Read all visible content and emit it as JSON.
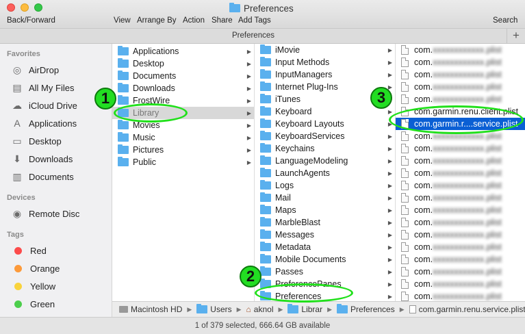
{
  "window": {
    "title": "Preferences",
    "toolbar": {
      "back_forward": "Back/Forward",
      "view": "View",
      "arrange_by": "Arrange By",
      "action": "Action",
      "share": "Share",
      "add_tags": "Add Tags",
      "search": "Search"
    },
    "tab_title": "Preferences",
    "plus": "+"
  },
  "sidebar": {
    "favorites_header": "Favorites",
    "favorites": [
      {
        "label": "AirDrop",
        "icon": "airdrop-icon"
      },
      {
        "label": "All My Files",
        "icon": "all-files-icon"
      },
      {
        "label": "iCloud Drive",
        "icon": "cloud-icon"
      },
      {
        "label": "Applications",
        "icon": "applications-icon"
      },
      {
        "label": "Desktop",
        "icon": "desktop-icon"
      },
      {
        "label": "Downloads",
        "icon": "downloads-icon"
      },
      {
        "label": "Documents",
        "icon": "documents-icon"
      }
    ],
    "devices_header": "Devices",
    "devices": [
      {
        "label": "Remote Disc",
        "icon": "disc-icon"
      }
    ],
    "tags_header": "Tags",
    "tags": [
      {
        "label": "Red",
        "color": "#fc4b4b"
      },
      {
        "label": "Orange",
        "color": "#fd9a3a"
      },
      {
        "label": "Yellow",
        "color": "#f9d33c"
      },
      {
        "label": "Green",
        "color": "#4cce4c"
      }
    ]
  },
  "column1": [
    {
      "label": "Applications"
    },
    {
      "label": "Desktop"
    },
    {
      "label": "Documents"
    },
    {
      "label": "Downloads"
    },
    {
      "label": "FrostWire"
    },
    {
      "label": "Library",
      "selected": true
    },
    {
      "label": "Movies"
    },
    {
      "label": "Music"
    },
    {
      "label": "Pictures"
    },
    {
      "label": "Public"
    }
  ],
  "column2": [
    "iMovie",
    "Input Methods",
    "InputManagers",
    "Internet Plug-Ins",
    "iTunes",
    "Keyboard",
    "Keyboard Layouts",
    "KeyboardServices",
    "Keychains",
    "LanguageModeling",
    "LaunchAgents",
    "Logs",
    "Mail",
    "Maps",
    "MarbleBlast",
    "Messages",
    "Metadata",
    "Mobile Documents",
    "Passes",
    "PreferencePanes",
    "Preferences"
  ],
  "column3": {
    "blurred_prefix": "com.",
    "visible_items": [
      {
        "label": "com.garmin.renu.client.plist",
        "index": 5
      },
      {
        "label": "com.garmin.r....service.plist",
        "index": 6,
        "selected": true
      }
    ],
    "blurred_fill": "xxxxxxxxxxxx.plist"
  },
  "pathbar": {
    "segments": [
      "Macintosh HD",
      "Users",
      "aknol",
      "Librar",
      "Preferences",
      "com.garmin.renu.service.plist"
    ]
  },
  "status": {
    "text": "1 of 379 selected, 666.64 GB available"
  },
  "annotations": [
    "1",
    "2",
    "3"
  ]
}
